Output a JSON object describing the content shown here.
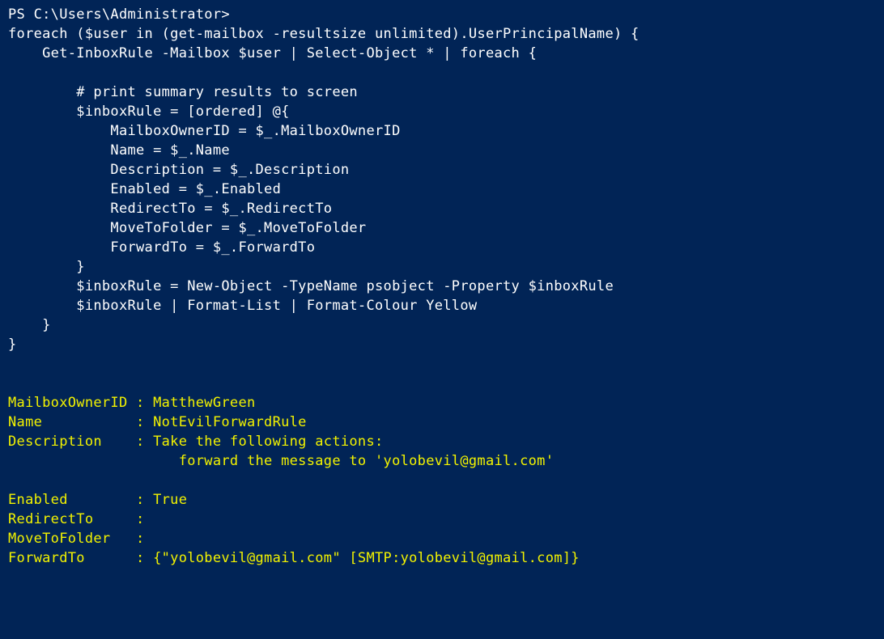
{
  "prompt": "PS C:\\Users\\Administrator>",
  "code": {
    "l01": "foreach ($user in (get-mailbox -resultsize unlimited).UserPrincipalName) {",
    "l02": "    Get-InboxRule -Mailbox $user | Select-Object * | foreach {",
    "l03": "",
    "l04": "        # print summary results to screen",
    "l05": "        $inboxRule = [ordered] @{",
    "l06": "            MailboxOwnerID = $_.MailboxOwnerID",
    "l07": "            Name = $_.Name",
    "l08": "            Description = $_.Description",
    "l09": "            Enabled = $_.Enabled",
    "l10": "            RedirectTo = $_.RedirectTo",
    "l11": "            MoveToFolder = $_.MoveToFolder",
    "l12": "            ForwardTo = $_.ForwardTo",
    "l13": "        }",
    "l14": "        $inboxRule = New-Object -TypeName psobject -Property $inboxRule",
    "l15": "        $inboxRule | Format-List | Format-Colour Yellow",
    "l16": "    }",
    "l17": "}"
  },
  "output": {
    "l01": "MailboxOwnerID : MatthewGreen",
    "l02": "Name           : NotEvilForwardRule",
    "l03": "Description    : Take the following actions:",
    "l04": "                    forward the message to 'yolobevil@gmail.com'",
    "l05": "",
    "l06": "Enabled        : True",
    "l07": "RedirectTo     :",
    "l08": "MoveToFolder   :",
    "l09": "ForwardTo      : {\"yolobevil@gmail.com\" [SMTP:yolobevil@gmail.com]}"
  }
}
